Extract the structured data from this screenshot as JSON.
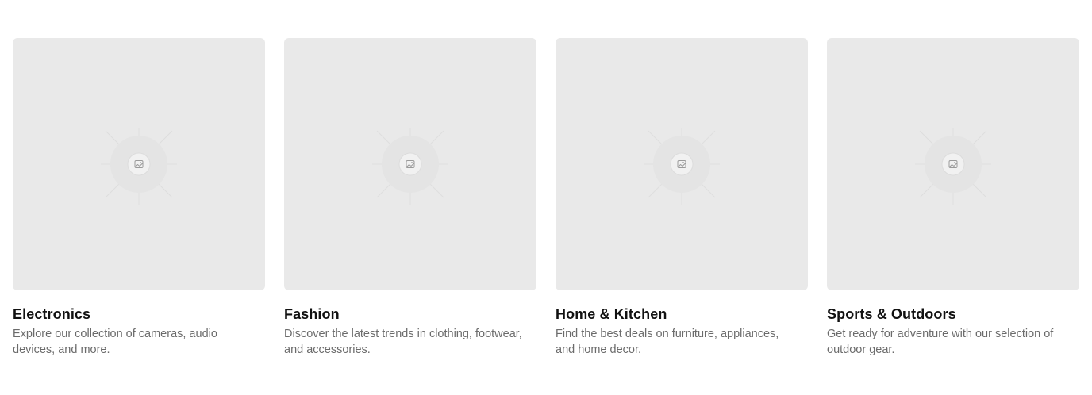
{
  "categories": [
    {
      "title": "Electronics",
      "description": "Explore our collection of cameras, audio devices, and more.",
      "image_icon": "image-placeholder-icon"
    },
    {
      "title": "Fashion",
      "description": "Discover the latest trends in clothing, footwear, and accessories.",
      "image_icon": "image-placeholder-icon"
    },
    {
      "title": "Home & Kitchen",
      "description": "Find the best deals on furniture, appliances, and home decor.",
      "image_icon": "image-placeholder-icon"
    },
    {
      "title": "Sports & Outdoors",
      "description": "Get ready for adventure with our selection of outdoor gear.",
      "image_icon": "image-placeholder-icon"
    }
  ],
  "colors": {
    "image_background": "#e9e9e9",
    "title": "#111111",
    "description": "#6b6b6b"
  }
}
